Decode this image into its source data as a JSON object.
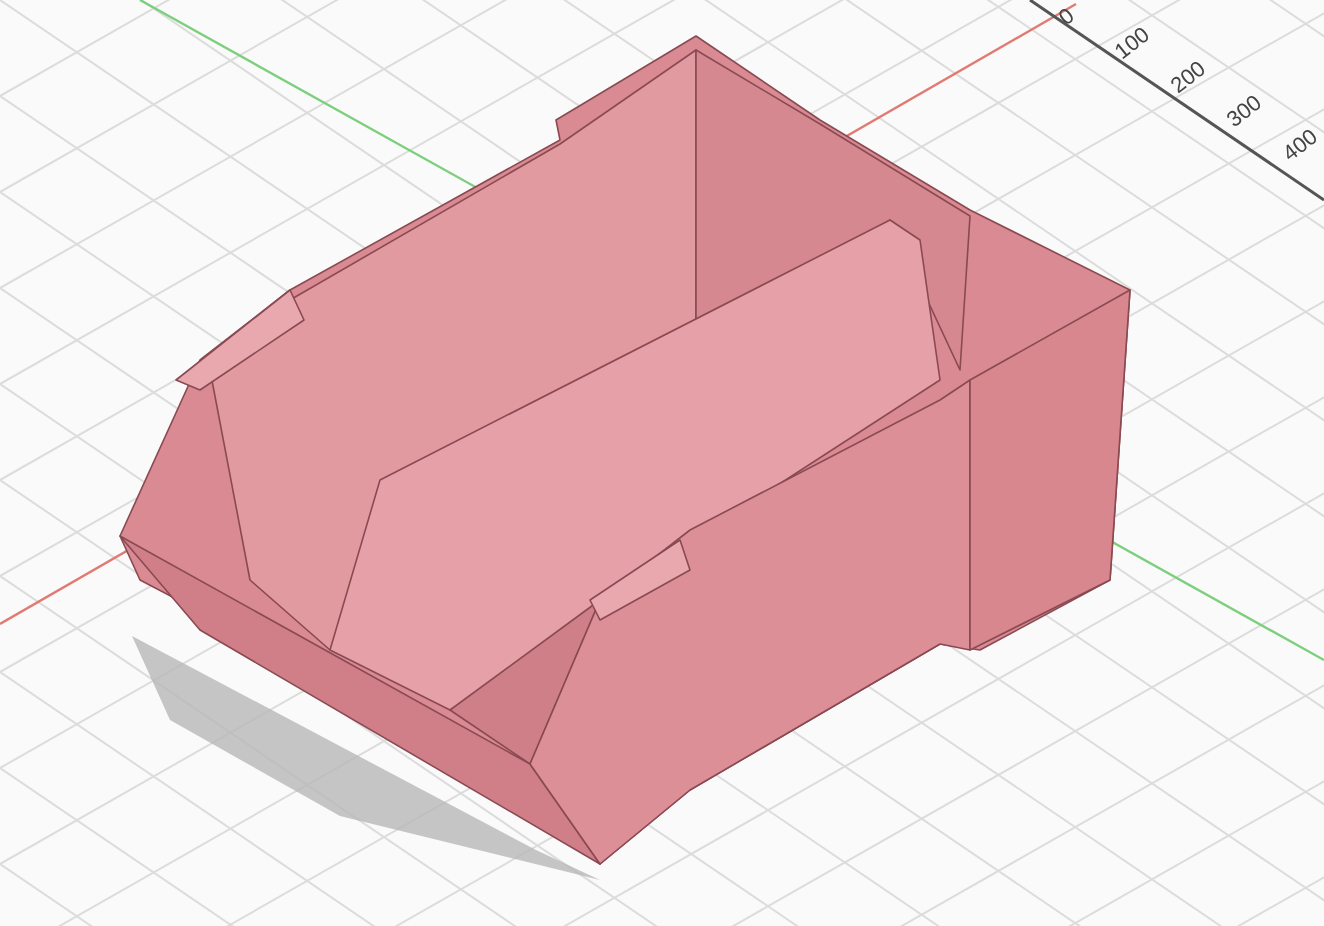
{
  "ruler": {
    "labels": [
      "0",
      "100",
      "200",
      "300",
      "400"
    ]
  }
}
